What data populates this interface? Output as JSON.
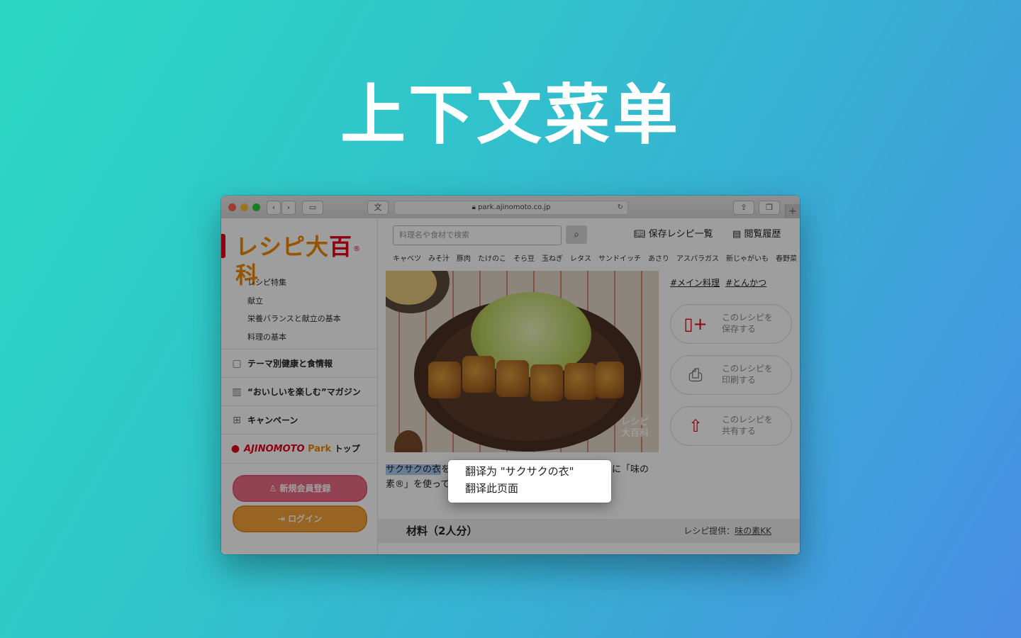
{
  "headline": "上下文菜单",
  "browser": {
    "url": "park.ajinomoto.co.jp",
    "translate_icon": "translate-icon",
    "new_tab_symbol": "+"
  },
  "sidebar": {
    "logo": {
      "part1": "レシピ",
      "part2": "大",
      "part3": "百",
      "part4": "科",
      "reg": "®"
    },
    "submenu": [
      "レシピ特集",
      "献立",
      "栄養バランスと献立の基本",
      "料理の基本"
    ],
    "items": [
      {
        "label": "テーマ別健康と食情報",
        "icon": "doc-icon"
      },
      {
        "label": "“おいしいを楽しむ”マガジン",
        "icon": "book-icon"
      },
      {
        "label": "キャンペーン",
        "icon": "gift-icon"
      }
    ],
    "brand": {
      "aji": "AJINOMOTO",
      "park": "Park",
      "top": "トップ"
    },
    "register_label": "新規会員登録",
    "login_label": "ログイン"
  },
  "header": {
    "search_placeholder": "料理名や食材で検索",
    "saved_list": "保存レシピ一覧",
    "history": "閲覧履歴",
    "tags": [
      "キャベツ",
      "みそ汁",
      "豚肉",
      "たけのこ",
      "そら豆",
      "玉ねぎ",
      "レタス",
      "サンドイッチ",
      "あさり",
      "アスパラガス",
      "新じゃがいも",
      "春野菜"
    ]
  },
  "recipe": {
    "photo_watermark_1": "レシピ",
    "photo_watermark_2": "大百科",
    "hashtags": [
      "#メイン料理",
      "#とんかつ"
    ],
    "actions": [
      {
        "line1": "このレシピを",
        "line2": "保存する",
        "icon": "bookmark-plus-icon"
      },
      {
        "line1": "このレシピを",
        "line2": "印刷する",
        "icon": "printer-icon"
      },
      {
        "line1": "このレシピを",
        "line2": "共有する",
        "icon": "share-icon"
      }
    ],
    "desc_selected": "サクサクの衣",
    "desc_line1_rest": "を",
    "desc_line2": "素®」を使って",
    "desc_right": "に「味の",
    "ingredients_title": "材料（2人分）",
    "credit_prefix": "レシピ提供：",
    "credit_link": "味の素KK"
  },
  "context_menu": {
    "items": [
      "翻译为 \"サクサクの衣\"",
      "翻译此页面"
    ]
  }
}
